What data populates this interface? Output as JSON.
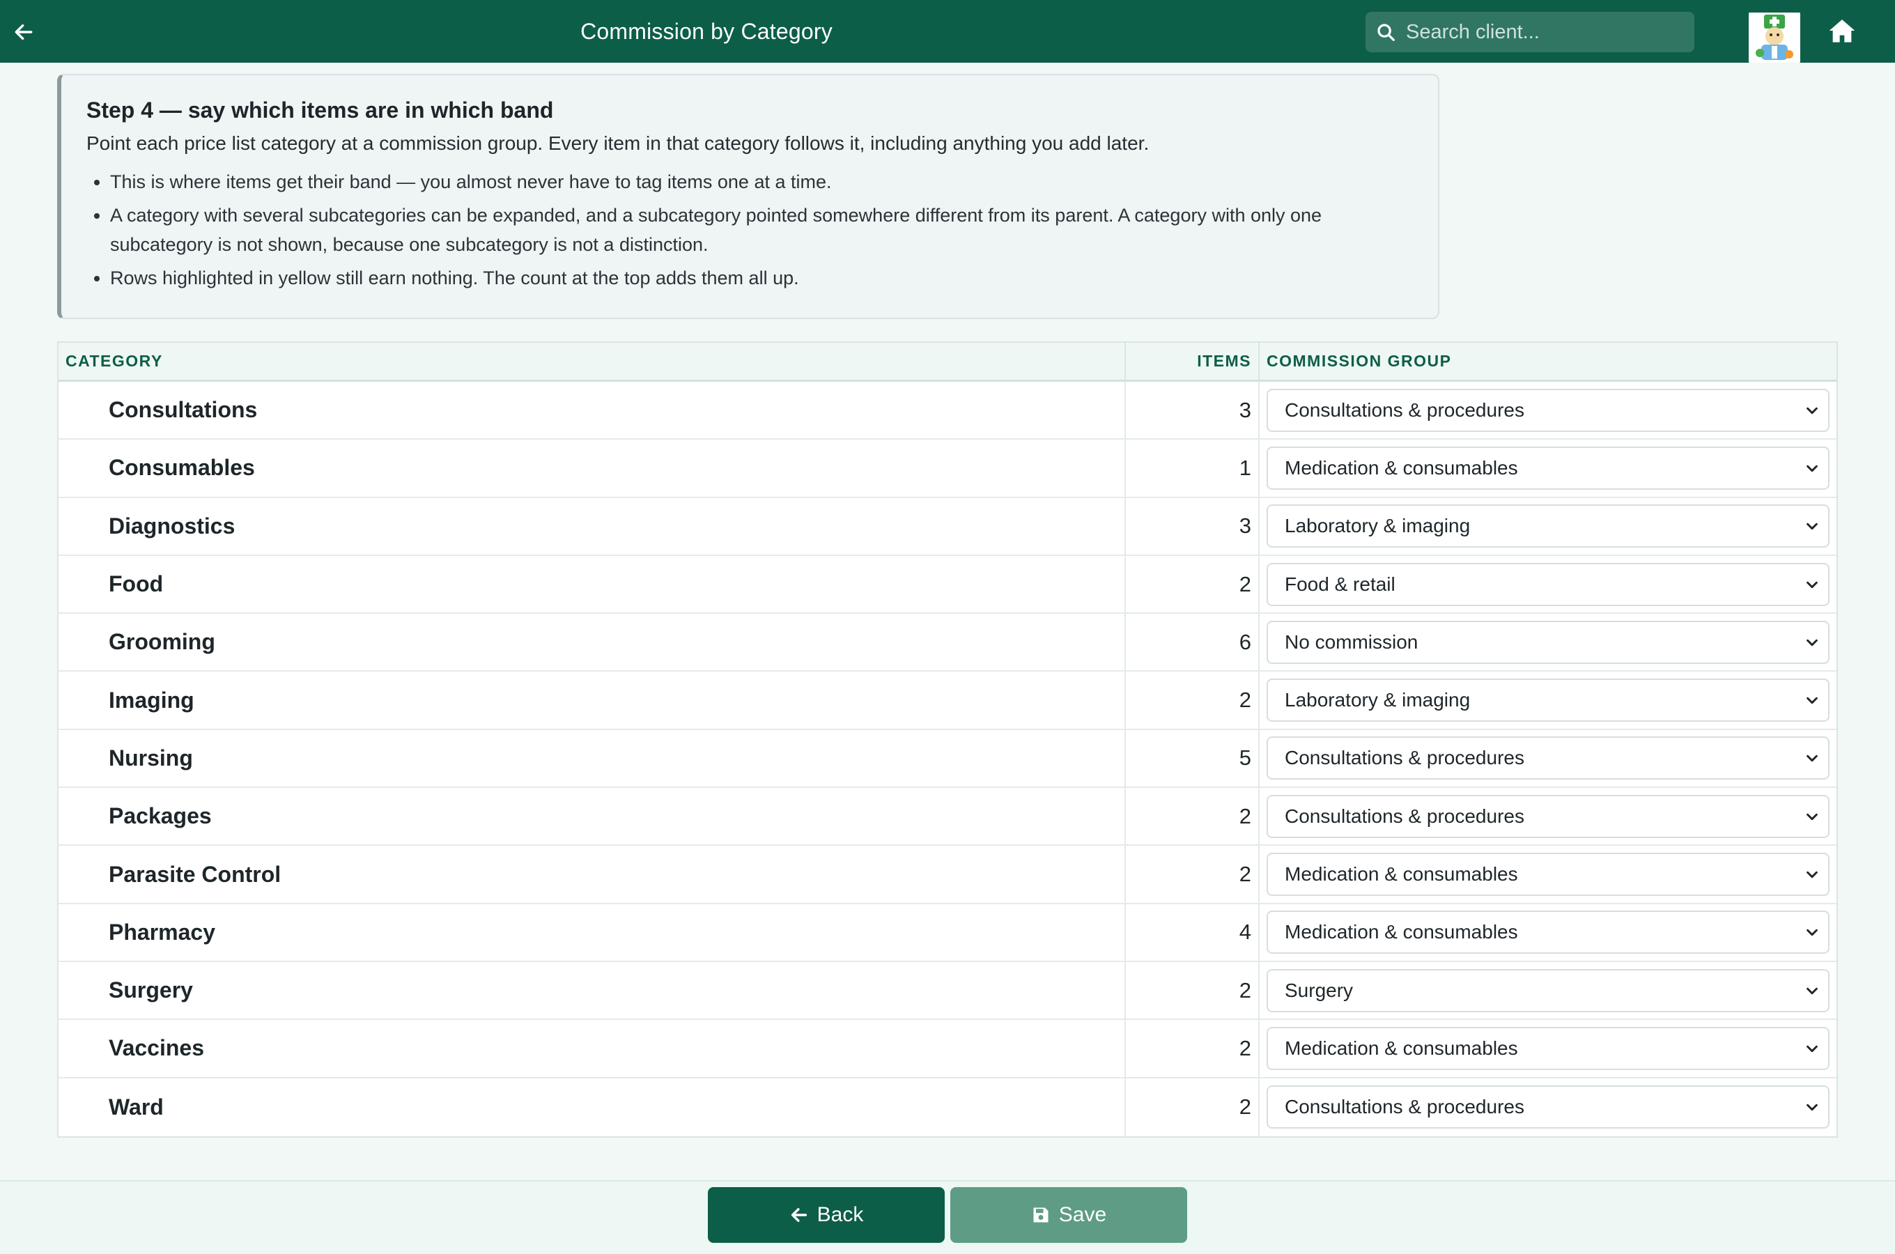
{
  "header": {
    "title": "Commission by Category",
    "search_placeholder": "Search client..."
  },
  "info": {
    "title": "Step 4 — say which items are in which band",
    "intro": "Point each price list category at a commission group. Every item in that category follows it, including anything you add later.",
    "bullets": [
      "This is where items get their band — you almost never have to tag items one at a time.",
      "A category with several subcategories can be expanded, and a subcategory pointed somewhere different from its parent. A category with only one subcategory is not shown, because one subcategory is not a distinction.",
      "Rows highlighted in yellow still earn nothing. The count at the top adds them all up."
    ]
  },
  "table": {
    "headers": {
      "category": "CATEGORY",
      "items": "ITEMS",
      "group": "COMMISSION GROUP"
    },
    "rows": [
      {
        "category": "Consultations",
        "items": "3",
        "group": "Consultations & procedures"
      },
      {
        "category": "Consumables",
        "items": "1",
        "group": "Medication & consumables"
      },
      {
        "category": "Diagnostics",
        "items": "3",
        "group": "Laboratory & imaging"
      },
      {
        "category": "Food",
        "items": "2",
        "group": "Food & retail"
      },
      {
        "category": "Grooming",
        "items": "6",
        "group": "No commission"
      },
      {
        "category": "Imaging",
        "items": "2",
        "group": "Laboratory & imaging"
      },
      {
        "category": "Nursing",
        "items": "5",
        "group": "Consultations & procedures"
      },
      {
        "category": "Packages",
        "items": "2",
        "group": "Consultations & procedures"
      },
      {
        "category": "Parasite Control",
        "items": "2",
        "group": "Medication & consumables"
      },
      {
        "category": "Pharmacy",
        "items": "4",
        "group": "Medication & consumables"
      },
      {
        "category": "Surgery",
        "items": "2",
        "group": "Surgery"
      },
      {
        "category": "Vaccines",
        "items": "2",
        "group": "Medication & consumables"
      },
      {
        "category": "Ward",
        "items": "2",
        "group": "Consultations & procedures"
      }
    ]
  },
  "footer": {
    "back_label": "Back",
    "save_label": "Save"
  },
  "colors": {
    "primary": "#0c5e48",
    "save_button": "#5e9c86"
  }
}
